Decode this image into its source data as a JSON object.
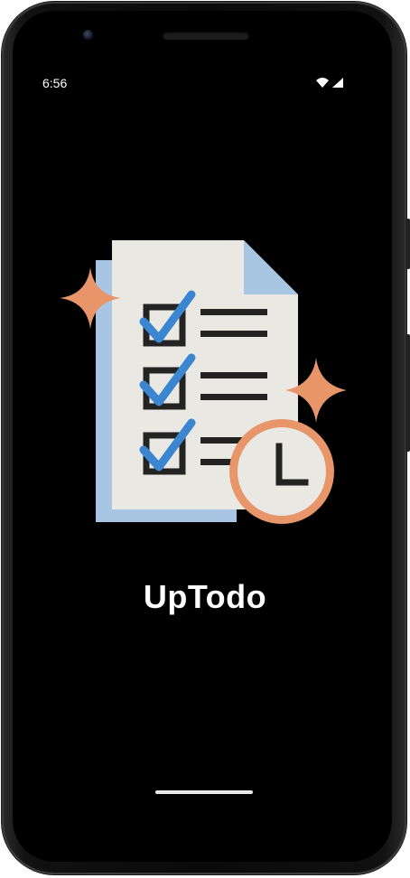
{
  "status_bar": {
    "time": "6:56",
    "icons": [
      "wifi-icon",
      "cellular-signal-icon"
    ]
  },
  "splash": {
    "app_name": "UpTodo",
    "illustration": "checklist-with-clock-illustration"
  },
  "colors": {
    "background": "#000000",
    "text": "#ffffff",
    "paper": "#e9e8e2",
    "paper_back": "#a8c6e3",
    "check_blue": "#3a86d0",
    "accent_orange": "#e8956a",
    "ink": "#232323"
  }
}
